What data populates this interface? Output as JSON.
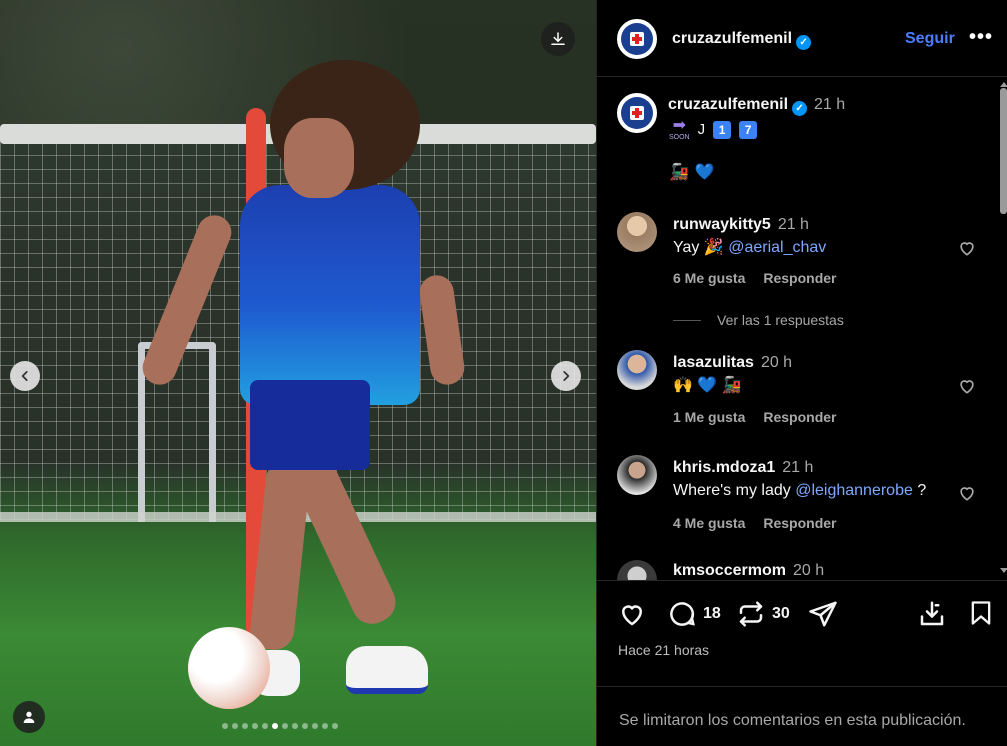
{
  "post": {
    "username": "cruzazulfemenil",
    "follow_label": "Seguir",
    "more_label": "•••",
    "caption_time": "21 h",
    "caption_line1": {
      "arrow_label": "SOON",
      "letter": "J",
      "digits": [
        "1",
        "7"
      ]
    },
    "caption_line2": [
      "🚂",
      "💙"
    ],
    "likes_time_ago": "Hace 21 horas",
    "comments_disabled_msg": "Se limitaron los comentarios en esta publicación.",
    "carousel": {
      "total_slides": 12,
      "active_slide": 5
    }
  },
  "comments": [
    {
      "username": "runwaykitty5",
      "time": "21 h",
      "text_prefix": "Yay 🎉 ",
      "mention": "@aerial_chav",
      "text_suffix": "",
      "likes": "6 Me gusta",
      "reply_label": "Responder",
      "view_replies": "Ver las 1 respuestas"
    },
    {
      "username": "lasazulitas",
      "time": "20 h",
      "text_prefix": "🙌 💙 🚂",
      "mention": "",
      "text_suffix": "",
      "likes": "1 Me gusta",
      "reply_label": "Responder"
    },
    {
      "username": "khris.mdoza1",
      "time": "21 h",
      "text_prefix": "Where's my lady ",
      "mention": "@leighannerobe",
      "text_suffix": " ?",
      "likes": "4 Me gusta",
      "reply_label": "Responder"
    },
    {
      "username": "kmsoccermom",
      "time": "20 h"
    }
  ],
  "actions": {
    "comment_count": "18",
    "repost_count": "30"
  },
  "icons": {
    "download": "download-icon",
    "prev": "chevron-left-icon",
    "next": "chevron-right-icon",
    "tag": "user-tag-icon",
    "like": "heart-icon",
    "comment": "comment-icon",
    "repost": "repost-icon",
    "share": "send-icon",
    "save_media": "save-to-device-icon",
    "bookmark": "bookmark-icon"
  },
  "colors": {
    "accent": "#4a7dff",
    "verified": "#0095f6",
    "background": "#000000"
  }
}
